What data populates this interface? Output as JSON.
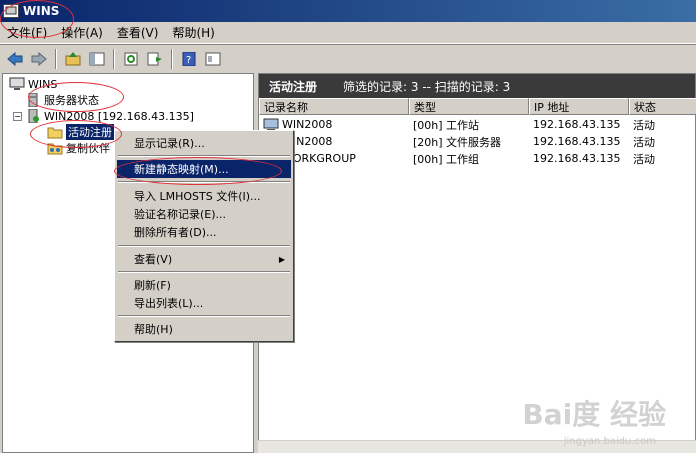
{
  "window": {
    "title": "WINS"
  },
  "menubar": [
    "文件(F)",
    "操作(A)",
    "查看(V)",
    "帮助(H)"
  ],
  "toolbar": {
    "buttons": [
      "back-icon",
      "forward-icon",
      "up-icon",
      "show-hide-tree-icon",
      "refresh-icon",
      "export-icon",
      "help-icon",
      "properties-icon"
    ]
  },
  "tree": {
    "root": "WINS",
    "server_status": "服务器状态",
    "server": "WIN2008 [192.168.43.135]",
    "active_registrations": "活动注册",
    "replication_partners": "复制伙伴"
  },
  "rightpane": {
    "title": "活动注册",
    "filtered": "筛选的记录: 3 -- 扫描的记录: 3",
    "columns": [
      "记录名称",
      "类型",
      "IP 地址",
      "状态"
    ],
    "rows": [
      {
        "name": "WIN2008",
        "type": "[00h] 工作站",
        "ip": "192.168.43.135",
        "status": "活动"
      },
      {
        "name": "WIN2008",
        "type": "[20h] 文件服务器",
        "ip": "192.168.43.135",
        "status": "活动"
      },
      {
        "name": "WORKGROUP",
        "type": "[00h] 工作组",
        "ip": "192.168.43.135",
        "status": "活动"
      }
    ]
  },
  "context_menu": {
    "items": [
      "显示记录(R)...",
      "新建静态映射(M)...",
      "导入 LMHOSTS 文件(I)...",
      "验证名称记录(E)...",
      "删除所有者(D)...",
      "查看(V)",
      "刷新(F)",
      "导出列表(L)...",
      "帮助(H)"
    ]
  },
  "watermark": {
    "logo": "Bai度 经验",
    "url": "jingyan.baidu.com"
  },
  "colors": {
    "title_bar": "#0a246a",
    "highlight": "#0a246a",
    "annotation": "#e0303a",
    "header_dark": "#3a3a3a"
  }
}
